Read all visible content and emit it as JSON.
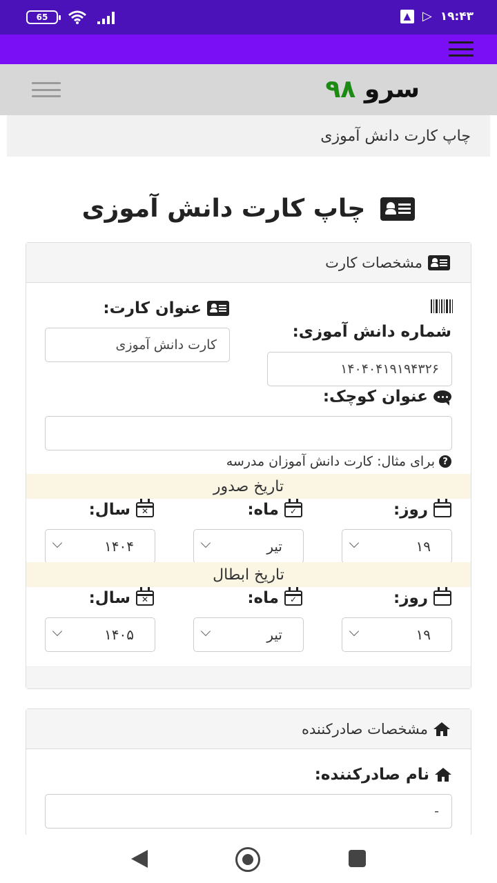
{
  "status_bar": {
    "battery": "65",
    "time": "۱۹:۴۳"
  },
  "navbar": {
    "brand_part1": "سرو",
    "brand_part2": "۹۸"
  },
  "breadcrumb": {
    "text": "چاپ کارت دانش آموزی"
  },
  "page": {
    "title": "چاپ کارت دانش آموزی"
  },
  "card_specs": {
    "header": "مشخصات کارت",
    "student_number_label": "شماره دانش آموزی:",
    "student_number_value": "۱۴۰۴۰۴۱۹۱۹۴۳۲۶",
    "card_title_label": "عنوان کارت:",
    "card_title_value": "کارت دانش آموزی",
    "small_title_label": "عنوان کوچک:",
    "small_title_value": "",
    "small_title_help": "برای مثال: کارت دانش آموزان مدرسه",
    "issue_date": {
      "heading": "تاریخ صدور",
      "day_label": "روز:",
      "day_value": "۱۹",
      "month_label": "ماه:",
      "month_value": "تیر",
      "year_label": "سال:",
      "year_value": "۱۴۰۴"
    },
    "expiry_date": {
      "heading": "تاریخ ابطال",
      "day_label": "روز:",
      "day_value": "۱۹",
      "month_label": "ماه:",
      "month_value": "تیر",
      "year_label": "سال:",
      "year_value": "۱۴۰۵"
    }
  },
  "issuer": {
    "header": "مشخصات صادرکننده",
    "name_label": "نام صادرکننده:",
    "name_value": "-"
  },
  "icons": {
    "id_card": "id-card-icon",
    "barcode": "barcode-icon",
    "comment": "comment-icon",
    "question": "question-circle-icon",
    "calendar": "calendar-icon",
    "calendar_check": "calendar-check-icon",
    "calendar_times": "calendar-times-icon",
    "home": "home-icon"
  },
  "colors": {
    "status_bar": "#4a12b8",
    "top_bar": "#7a0ff5",
    "brand_number": "#1d8a14",
    "date_band": "#fbf6e3"
  }
}
